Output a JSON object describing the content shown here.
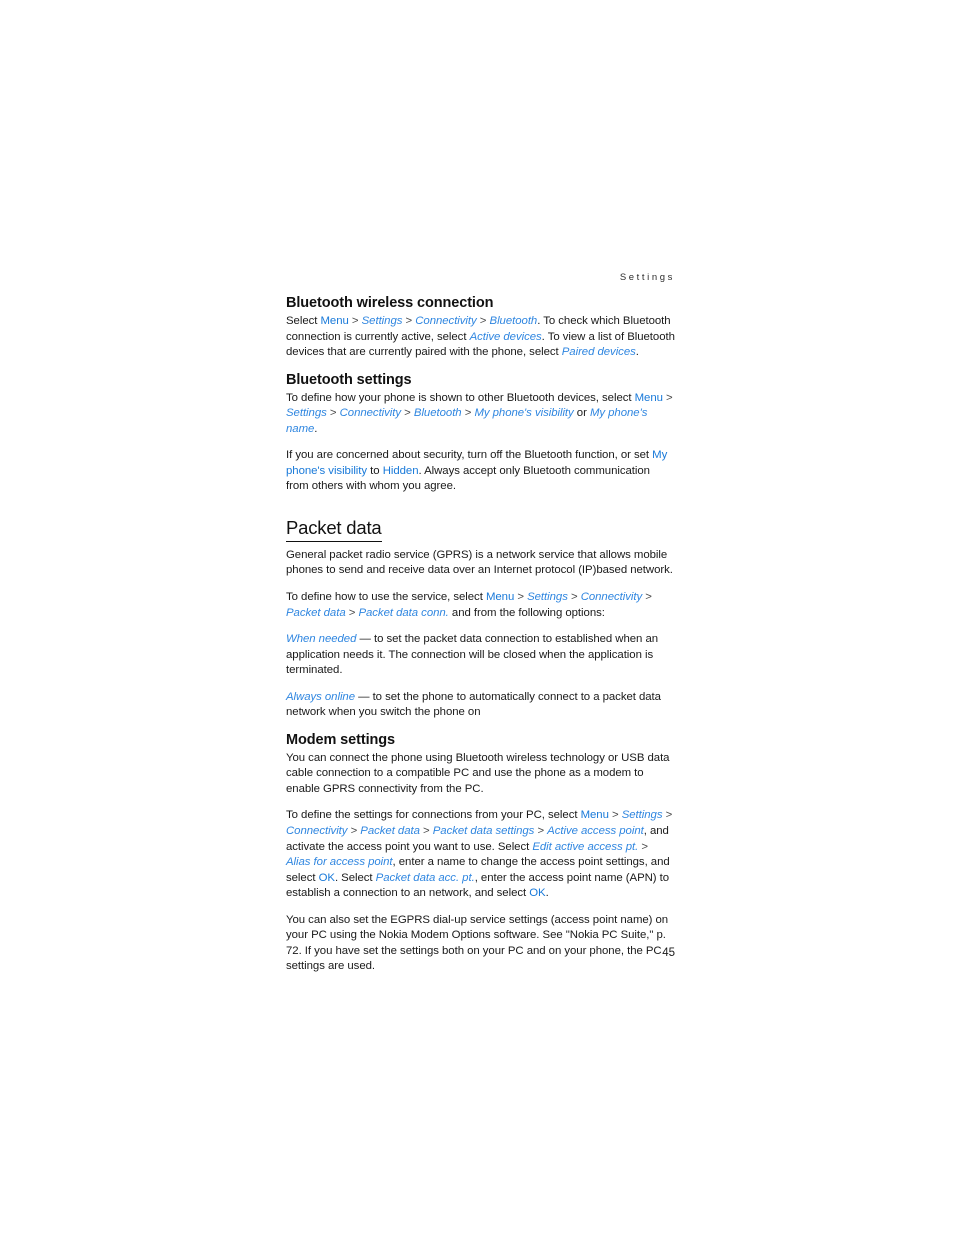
{
  "running_header": "Settings",
  "page_number": "45",
  "colors": {
    "link_blue": "#1879d9",
    "link_blue_italic": "#2f86e0",
    "text": "#1a1a1a"
  },
  "sections": {
    "bluetooth_wireless_connection": {
      "heading": "Bluetooth wireless connection",
      "p1": {
        "t1": "Select ",
        "l1": "Menu",
        "s1": " > ",
        "l2": "Settings",
        "s2": " > ",
        "l3": "Connectivity",
        "s3": " > ",
        "l4": "Bluetooth",
        "t2": ". To check which Bluetooth connection is currently active, select ",
        "l5": "Active devices",
        "t3": ". To view a list of Bluetooth devices that are currently paired with the phone, select ",
        "l6": "Paired devices",
        "t4": "."
      }
    },
    "bluetooth_settings": {
      "heading": "Bluetooth settings",
      "p1": {
        "t1": "To define how your phone is shown to other Bluetooth devices, select ",
        "l1": "Menu",
        "s1": " > ",
        "l2": "Settings",
        "s2": " > ",
        "l3": "Connectivity",
        "s3": " > ",
        "l4": "Bluetooth",
        "s4": " > ",
        "l5": "My phone's visibility",
        "t2": " or ",
        "l6": "My phone's name",
        "t3": "."
      },
      "p2": {
        "t1": "If you are concerned about security, turn off the Bluetooth function, or set ",
        "l1": "My phone's visibility",
        "t2": " to ",
        "l2": "Hidden",
        "t3": ". Always accept only Bluetooth communication from others with whom you agree."
      }
    },
    "packet_data": {
      "heading": "Packet data",
      "p1": "General packet radio service (GPRS) is a network service that allows mobile phones to send and receive data over an Internet protocol (IP)based network.",
      "p2": {
        "t1": "To define how to use the service, select ",
        "l1": "Menu",
        "s1": " > ",
        "l2": "Settings",
        "s2": " > ",
        "l3": "Connectivity",
        "s3": " > ",
        "l4": "Packet data",
        "s4": " > ",
        "l5": "Packet data conn.",
        "t2": " and from the following options:"
      },
      "option_when_needed": {
        "label": "When needed",
        "text": " — to set the packet data connection to established when an application needs it. The connection will be closed when the application is terminated."
      },
      "option_always_online": {
        "label": "Always online",
        "text": " — to set the phone to automatically connect to a packet data network when you switch the phone on"
      }
    },
    "modem_settings": {
      "heading": "Modem settings",
      "p1": "You can connect the phone using Bluetooth wireless technology or USB data cable connection to a compatible PC and use the phone as a modem to enable GPRS connectivity from the PC.",
      "p2": {
        "t1": "To define the settings for connections from your PC, select ",
        "l1": "Menu",
        "s1": " > ",
        "l2": "Settings",
        "s2": " > ",
        "l3": "Connectivity",
        "s3": " > ",
        "l4": "Packet data",
        "s4": " > ",
        "l5": "Packet data settings",
        "s5": " > ",
        "l6": "Active access point",
        "t2": ", and activate the access point you want to use. Select ",
        "l7": "Edit active access pt.",
        "s6": " > ",
        "l8": "Alias for access point",
        "t3": ", enter a name to change the access point settings, and select ",
        "l9": "OK",
        "t4": ". Select ",
        "l10": "Packet data acc. pt.",
        "t5": ", enter the access point name (APN) to establish a connection to an network, and select ",
        "l11": "OK",
        "t6": "."
      },
      "p3": "You can also set the EGPRS dial-up service settings (access point name) on your PC using the Nokia Modem Options software. See \"Nokia PC Suite,\" p. 72. If you have set the settings both on your PC and on your phone, the PC settings are used."
    }
  }
}
